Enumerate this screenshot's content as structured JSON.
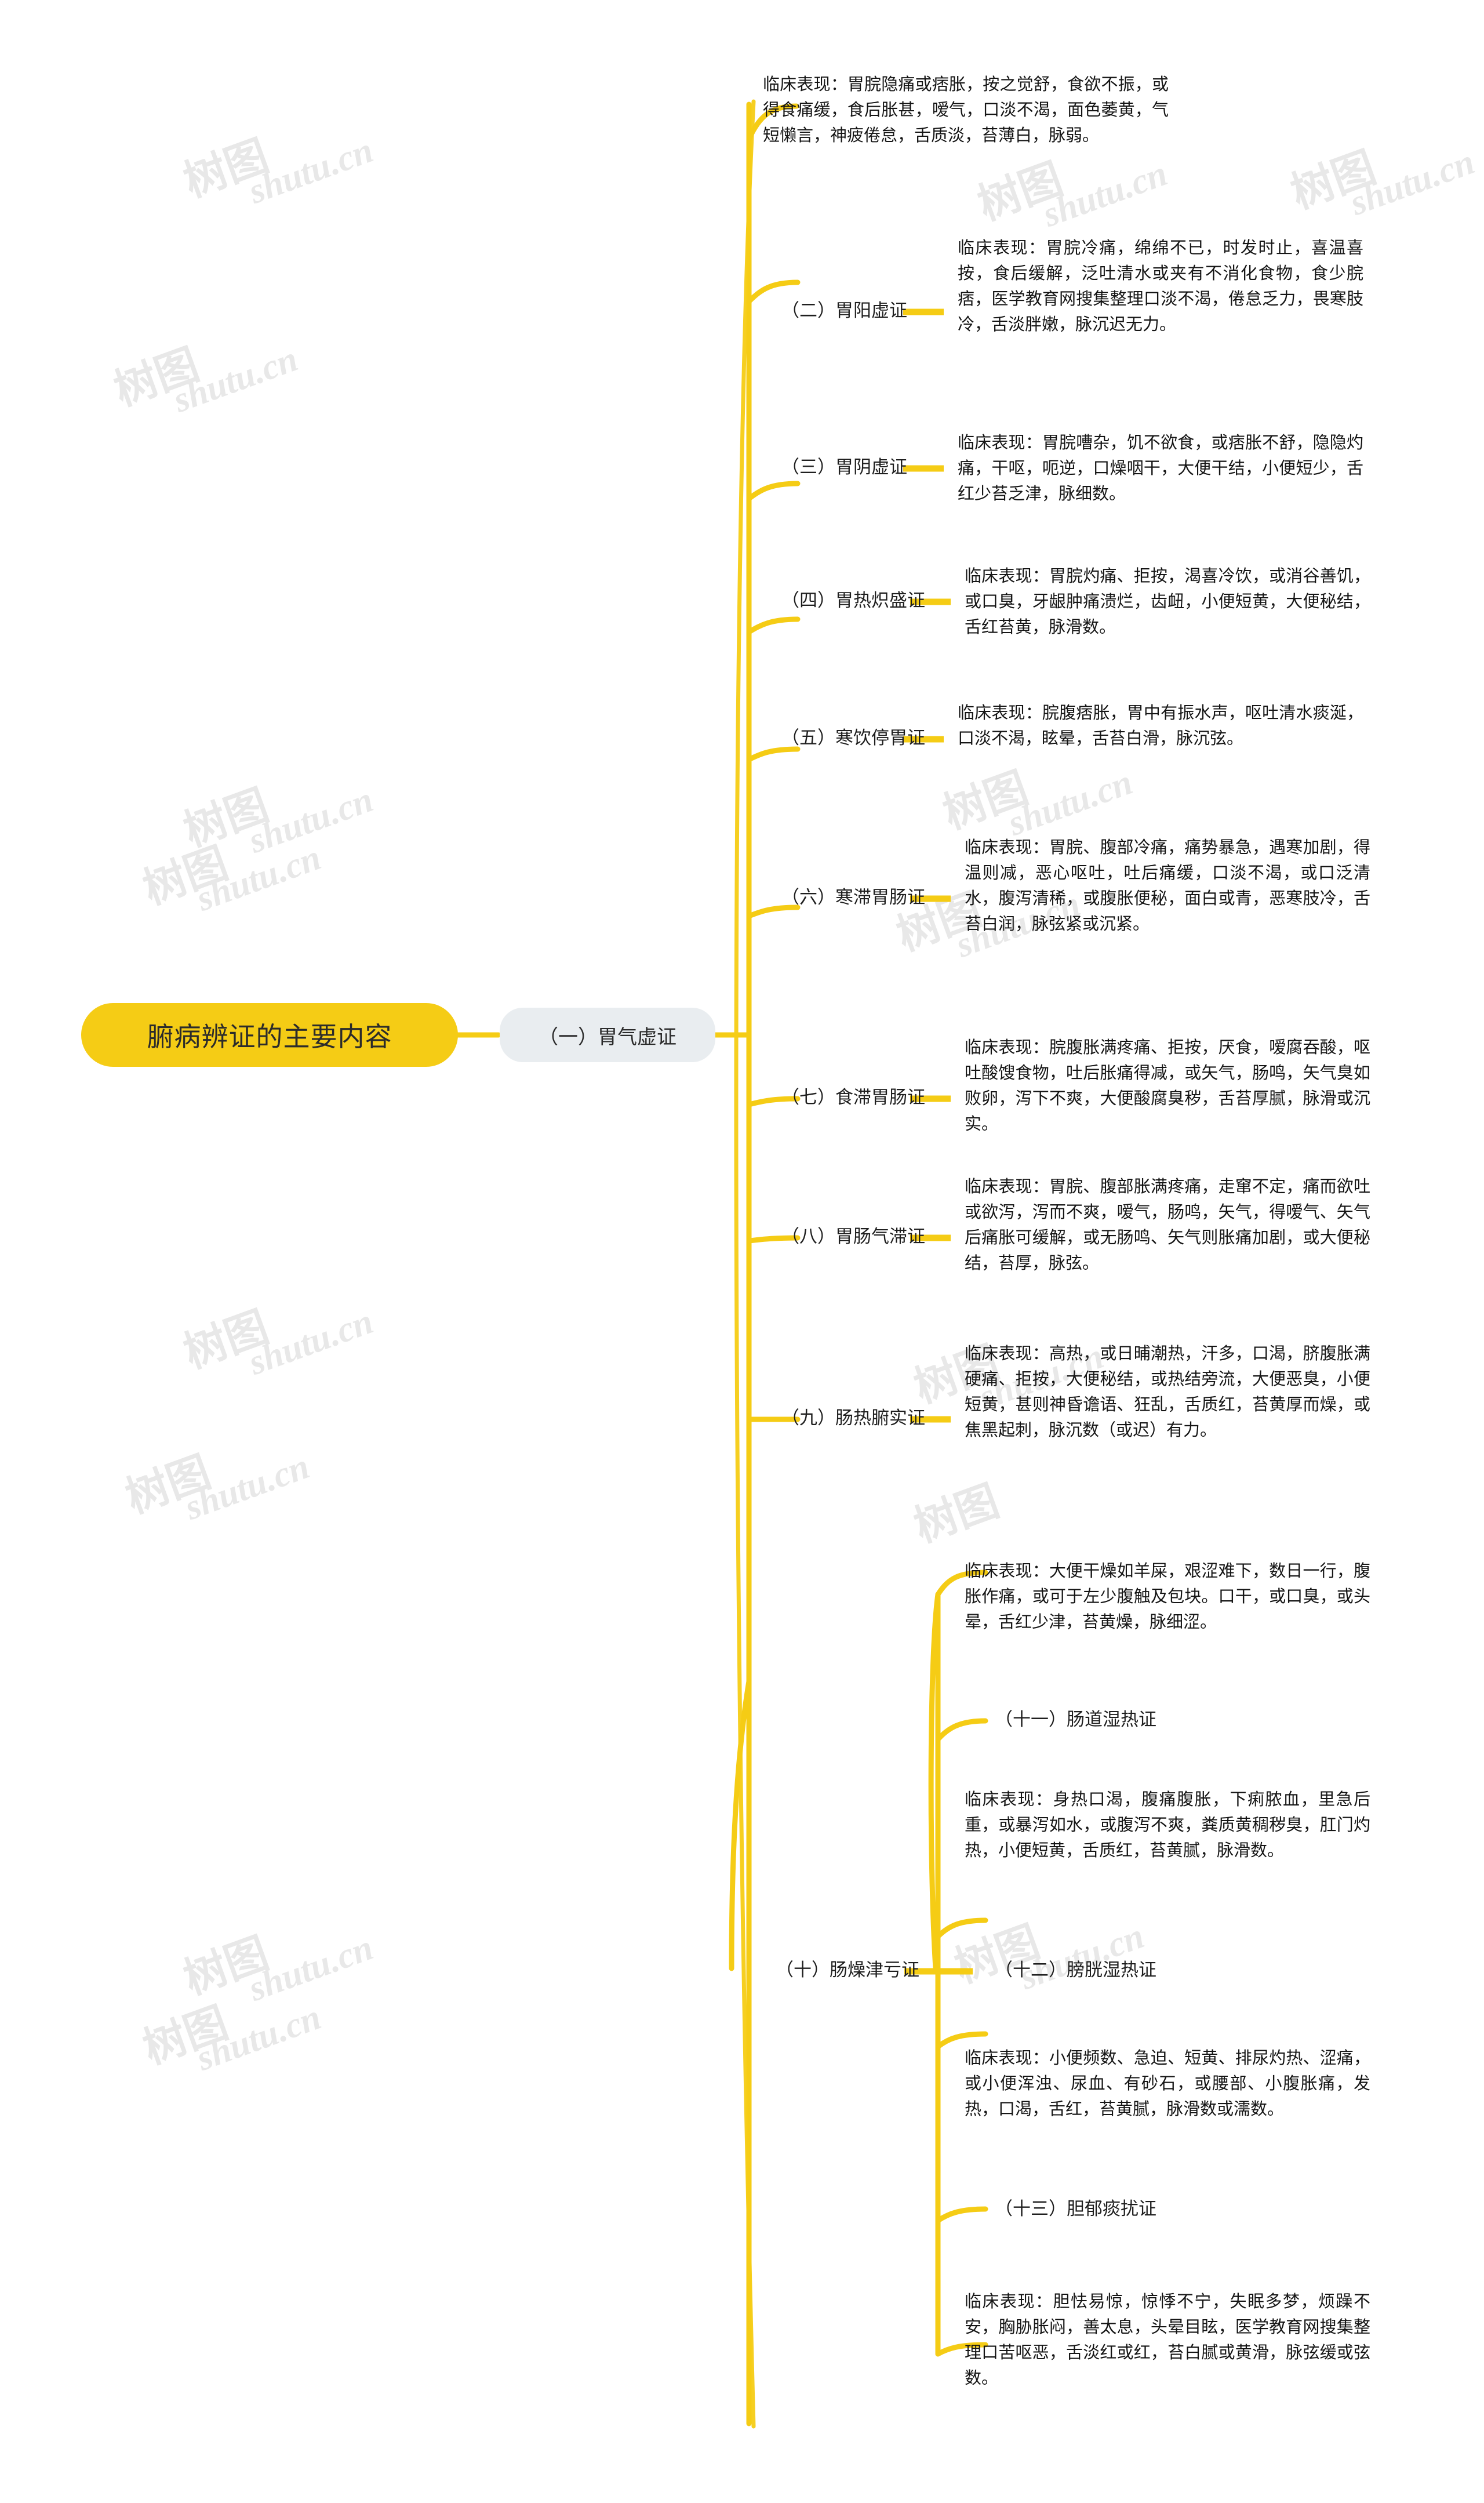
{
  "meta": {
    "watermark_text_cn": "树图",
    "watermark_text_en": "shutu.cn",
    "accent_color": "#F5CC15",
    "node_bg_color": "#E9EDF0",
    "text_color": "#151515",
    "background": "#ffffff"
  },
  "root": {
    "label": "腑病辨证的主要内容"
  },
  "level2": {
    "label": "（一）胃气虚证"
  },
  "branches": [
    {
      "id": "b1",
      "label": "",
      "clinical": "临床表现：胃脘隐痛或痞胀，按之觉舒，食欲不振，或得食痛缓，食后胀甚，嗳气，口淡不渴，面色萎黄，气短懒言，神疲倦怠，舌质淡，苔薄白，脉弱。"
    },
    {
      "id": "b2",
      "label": "（二）胃阳虚证",
      "clinical": "临床表现：胃脘冷痛，绵绵不已，时发时止，喜温喜按，食后缓解，泛吐清水或夹有不消化食物，食少脘痞，医学教育网搜集整理口淡不渴，倦怠乏力，畏寒肢冷，舌淡胖嫩，脉沉迟无力。"
    },
    {
      "id": "b3",
      "label": "（三）胃阴虚证",
      "clinical": "临床表现：胃脘嘈杂，饥不欲食，或痞胀不舒，隐隐灼痛，干呕，呃逆，口燥咽干，大便干结，小便短少，舌红少苔乏津，脉细数。"
    },
    {
      "id": "b4",
      "label": "（四）胃热炽盛证",
      "clinical": "临床表现：胃脘灼痛、拒按，渴喜冷饮，或消谷善饥，或口臭，牙龈肿痛溃烂，齿衄，小便短黄，大便秘结，舌红苔黄，脉滑数。"
    },
    {
      "id": "b5",
      "label": "（五）寒饮停胃证",
      "clinical": "临床表现：脘腹痞胀，胃中有振水声，呕吐清水痰涎，口淡不渴，眩晕，舌苔白滑，脉沉弦。"
    },
    {
      "id": "b6",
      "label": "（六）寒滞胃肠证",
      "clinical": "临床表现：胃脘、腹部冷痛，痛势暴急，遇寒加剧，得温则减，恶心呕吐，吐后痛缓，口淡不渴，或口泛清水，腹泻清稀，或腹胀便秘，面白或青，恶寒肢冷，舌苔白润，脉弦紧或沉紧。"
    },
    {
      "id": "b7",
      "label": "（七）食滞胃肠证",
      "clinical": "临床表现：脘腹胀满疼痛、拒按，厌食，嗳腐吞酸，呕吐酸馊食物，吐后胀痛得减，或矢气，肠鸣，矢气臭如败卵，泻下不爽，大便酸腐臭秽，舌苔厚腻，脉滑或沉实。"
    },
    {
      "id": "b8",
      "label": "（八）胃肠气滞证",
      "clinical": "临床表现：胃脘、腹部胀满疼痛，走窜不定，痛而欲吐或欲泻，泻而不爽，嗳气，肠鸣，矢气，得嗳气、矢气后痛胀可缓解，或无肠鸣、矢气则胀痛加剧，或大便秘结，苔厚，脉弦。"
    },
    {
      "id": "b9",
      "label": "（九）肠热腑实证",
      "clinical": "临床表现：高热，或日晡潮热，汗多，口渴，脐腹胀满硬痛、拒按，大便秘结，或热结旁流，大便恶臭，小便短黄，甚则神昏谵语、狂乱，舌质红，苔黄厚而燥，或焦黑起刺，脉沉数（或迟）有力。"
    }
  ],
  "branch10": {
    "label": "（十）肠燥津亏证",
    "clinical": "临床表现：大便干燥如羊屎，艰涩难下，数日一行，腹胀作痛，或可于左少腹触及包块。口干，或口臭，或头晕，舌红少津，苔黄燥，脉细涩。",
    "children": [
      {
        "id": "c11",
        "label": "（十一）肠道湿热证",
        "clinical": "临床表现：身热口渴，腹痛腹胀，下痢脓血，里急后重，或暴泻如水，或腹泻不爽，粪质黄稠秽臭，肛门灼热，小便短黄，舌质红，苔黄腻，脉滑数。"
      },
      {
        "id": "c12",
        "label": "（十二）膀胱湿热证",
        "clinical": "临床表现：小便频数、急迫、短黄、排尿灼热、涩痛，或小便浑浊、尿血、有砂石，或腰部、小腹胀痛，发热，口渴，舌红，苔黄腻，脉滑数或濡数。"
      },
      {
        "id": "c13",
        "label": "（十三）胆郁痰扰证",
        "clinical": "临床表现：胆怯易惊，惊悸不宁，失眠多梦，烦躁不安，胸胁胀闷，善太息，头晕目眩，医学教育网搜集整理口苦呕恶，舌淡红或红，苔白腻或黄滑，脉弦缓或弦数。"
      }
    ]
  }
}
